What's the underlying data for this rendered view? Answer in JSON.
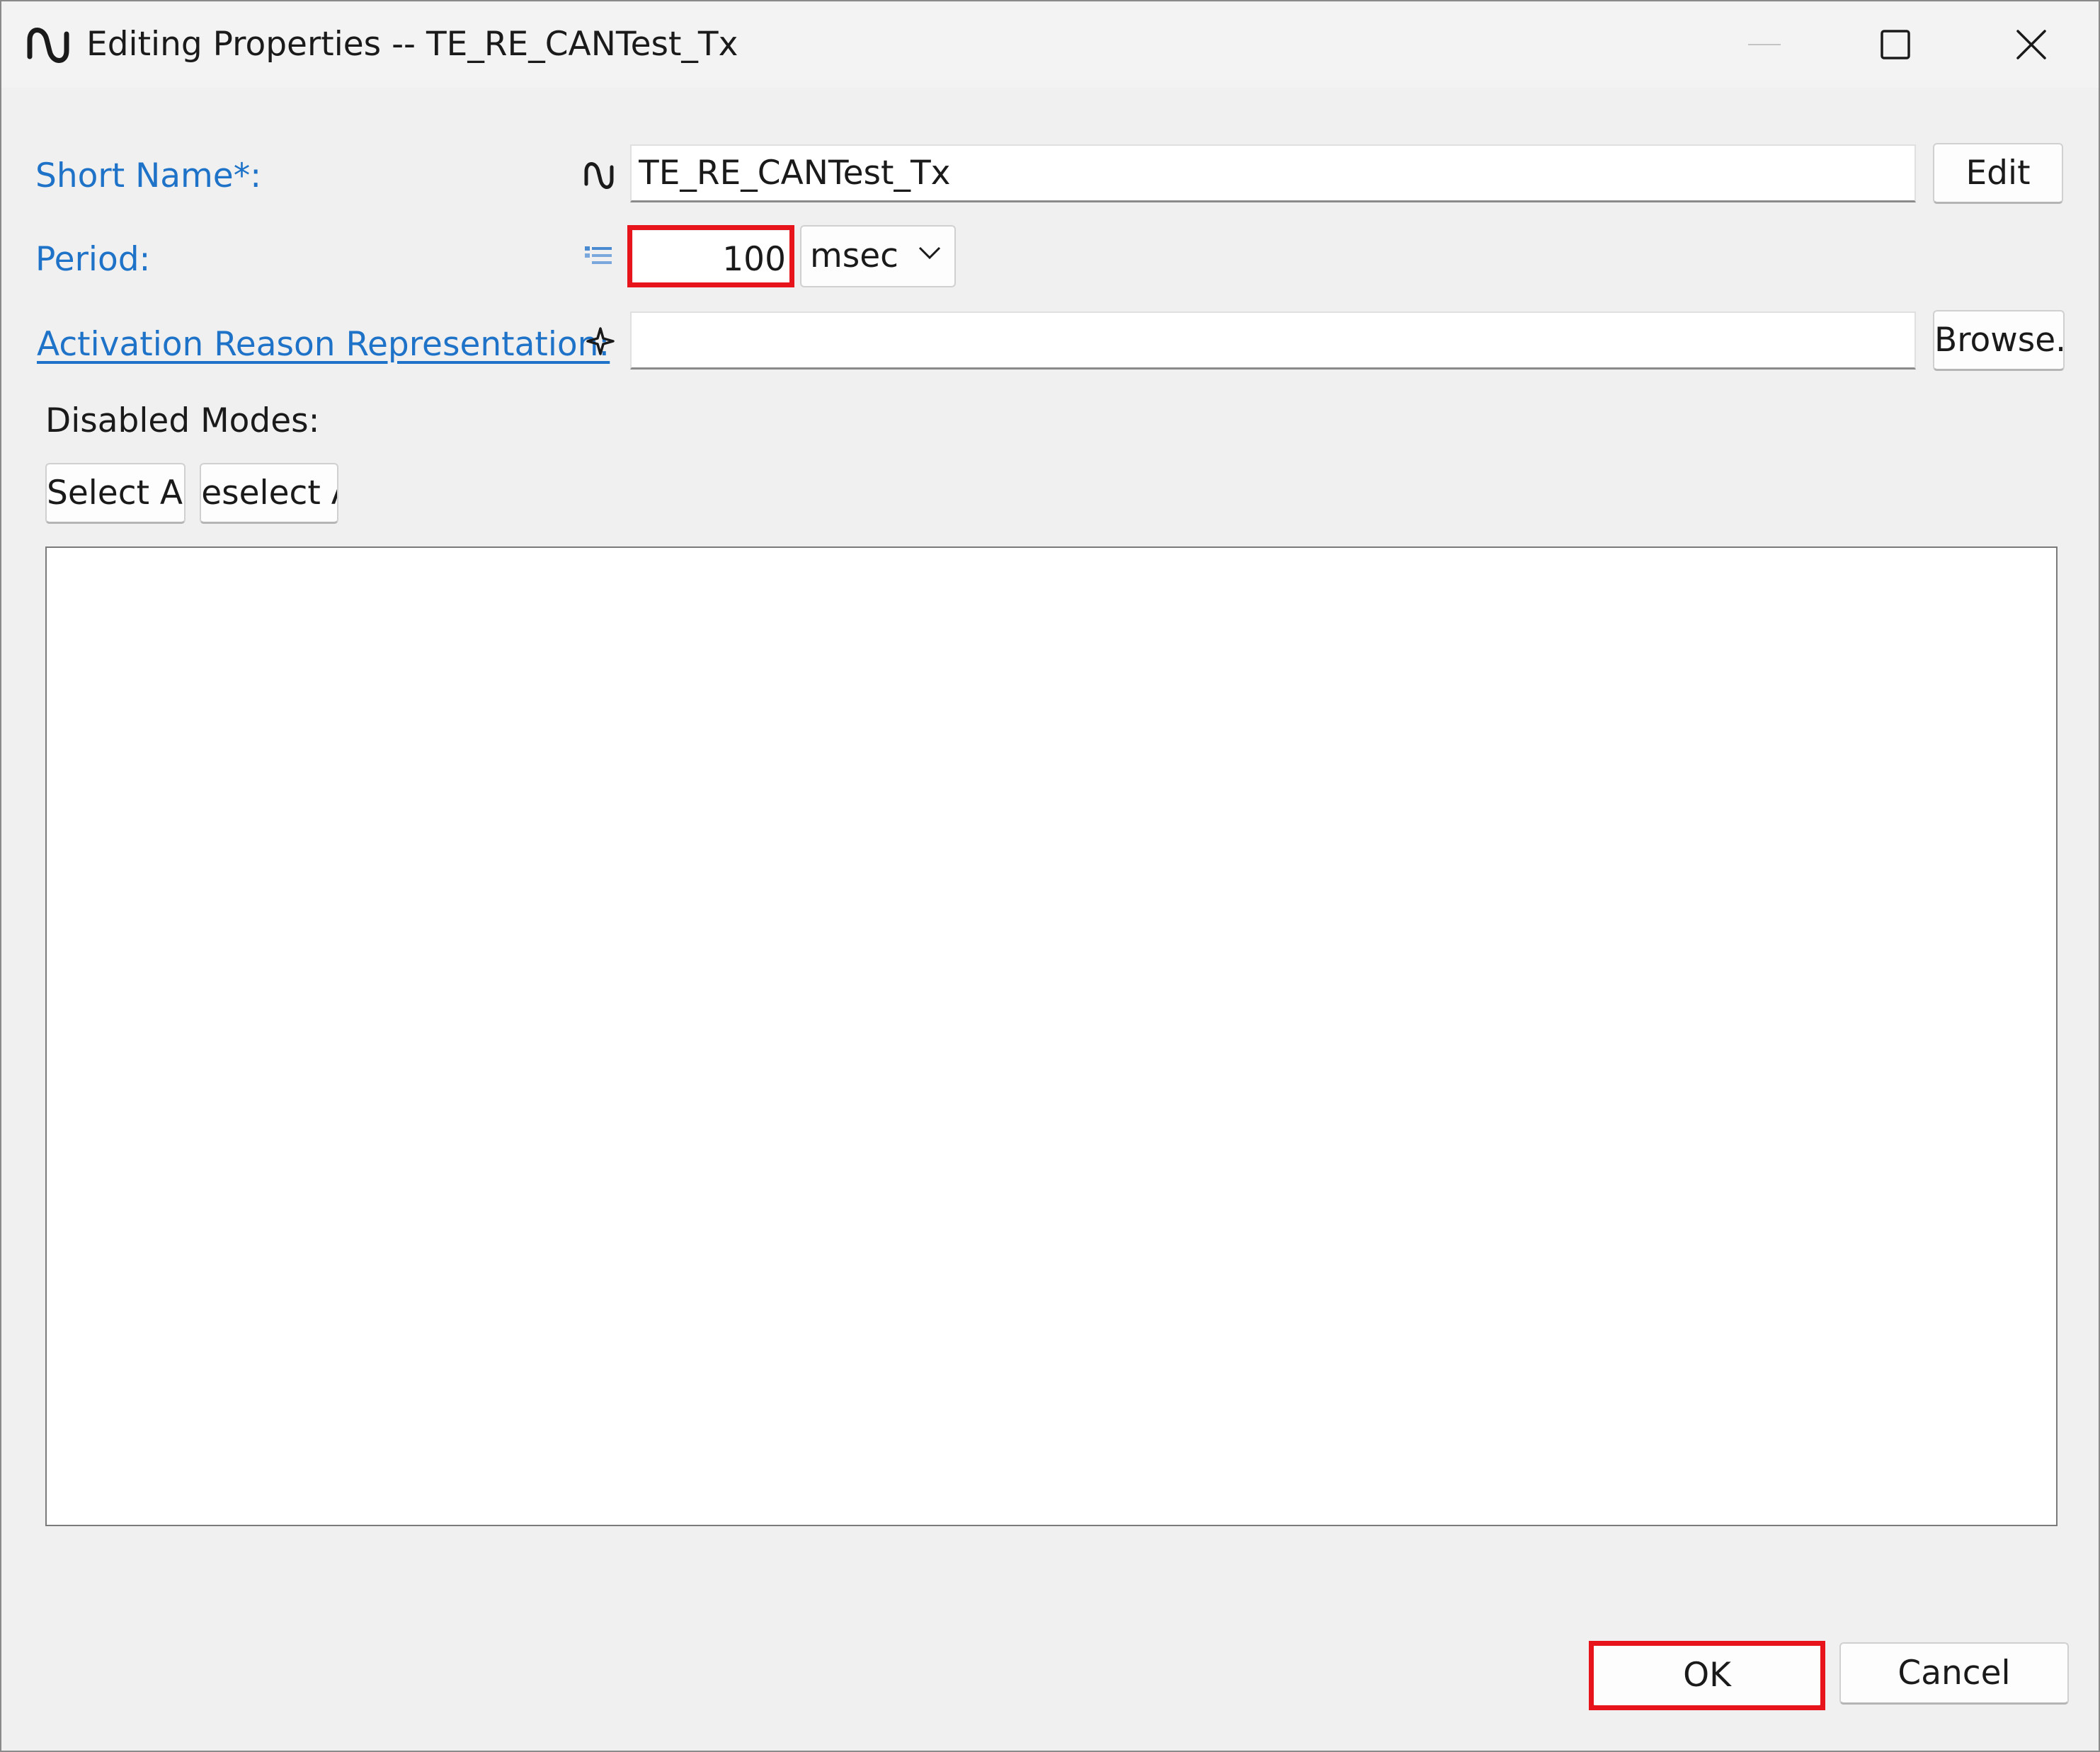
{
  "window": {
    "title": "Editing Properties -- TE_RE_CANTest_Tx",
    "icon": "sine-wave-icon",
    "controls": [
      "minimize-icon",
      "maximize-icon",
      "close-icon"
    ]
  },
  "form": {
    "short_name": {
      "label": "Short Name*:",
      "icon": "sine-wave-icon",
      "value": "TE_RE_CANTest_Tx",
      "button": "Edit"
    },
    "period": {
      "label": "Period:",
      "icon": "list-value-icon",
      "value": "100",
      "unit": "msec"
    },
    "activation_reason": {
      "label": "Activation Reason Representation:",
      "icon": "reference-star-icon",
      "value": "",
      "button": "Browse..."
    },
    "disabled_modes": {
      "label": "Disabled Modes:",
      "select_all": "Select All",
      "deselect_all": "Deselect All",
      "items": []
    }
  },
  "footer": {
    "ok": "OK",
    "cancel": "Cancel"
  },
  "colors": {
    "highlight": "#e8141c",
    "label_link": "#1e73c8"
  }
}
